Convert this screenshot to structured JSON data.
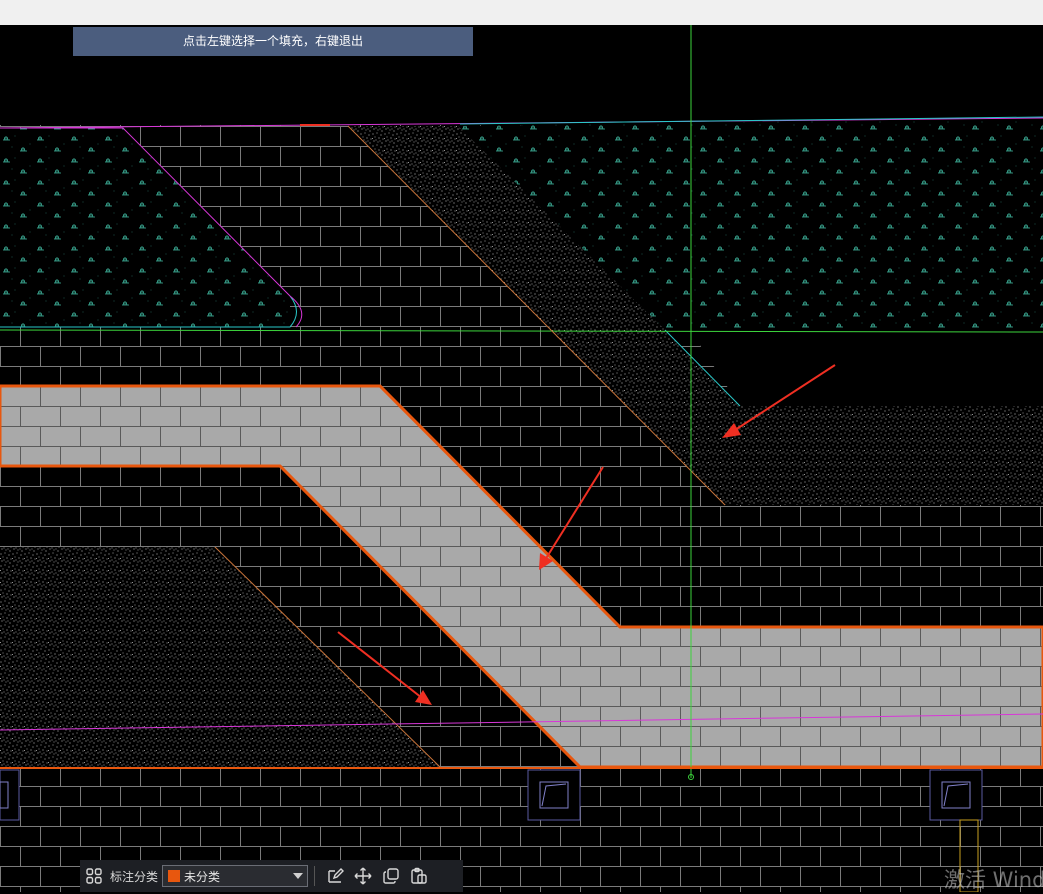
{
  "prompt": {
    "text": "点击左键选择一个填充，右键退出"
  },
  "bottom_toolbar": {
    "category_label": "标注分类",
    "category_select": {
      "selected": "未分类",
      "swatch_color": "#e8570e"
    }
  },
  "watermark": {
    "text": "激活 Windo"
  },
  "colors": {
    "hatch_fill": "#a9a9a9",
    "outline": "#e8570e",
    "crosshair": "#3cd43c",
    "polyline_magenta": "#d836d8",
    "leader_arrow": "#ef2f22",
    "boundary_cyan": "#29c8c8"
  }
}
